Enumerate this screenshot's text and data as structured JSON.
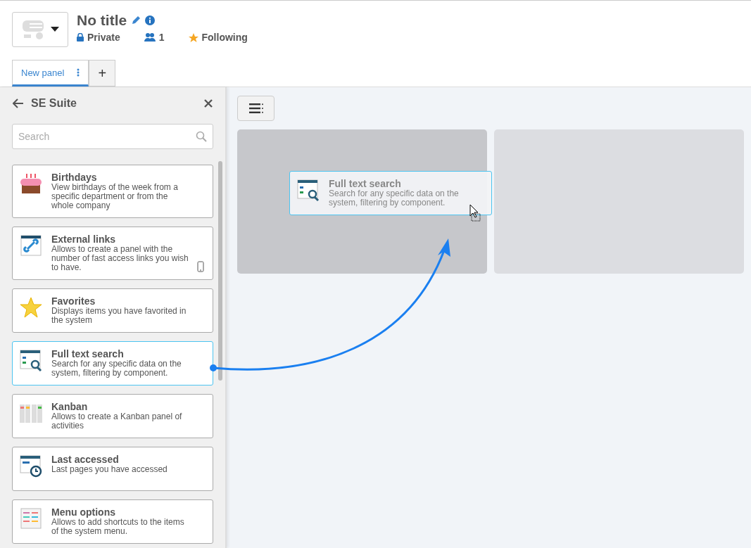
{
  "header": {
    "title": "No title",
    "privacy": "Private",
    "members": "1",
    "follow": "Following"
  },
  "tabs": [
    {
      "label": "New panel",
      "selected": true
    },
    {
      "label": "+",
      "selected": false
    }
  ],
  "sidebar": {
    "title": "SE Suite",
    "search": {
      "placeholder": "Search"
    },
    "widgets": [
      {
        "kind": "birthdays",
        "title": "Birthdays",
        "description": "View birthdays of the week from a specific department or from the whole company",
        "selected": false,
        "mobile": false
      },
      {
        "kind": "links",
        "title": "External links",
        "description": "Allows to create a panel with the number of fast access links you wish to have.",
        "selected": false,
        "mobile": true
      },
      {
        "kind": "favorites",
        "title": "Favorites",
        "description": "Displays items you have favorited in the system",
        "selected": false,
        "mobile": false
      },
      {
        "kind": "search",
        "title": "Full text search",
        "description": "Search for any specific data on the system, filtering by component.",
        "selected": true,
        "mobile": false
      },
      {
        "kind": "kanban",
        "title": "Kanban",
        "description": "Allows to create a Kanban panel of activities",
        "selected": false,
        "mobile": false
      },
      {
        "kind": "recent",
        "title": "Last accessed",
        "description": "Last pages you have accessed",
        "selected": false,
        "mobile": false
      },
      {
        "kind": "menu",
        "title": "Menu options",
        "description": "Allows to add shortcuts to the items of the system menu.",
        "selected": false,
        "mobile": false
      }
    ]
  },
  "drop_zones": [
    {
      "highlighted": true
    },
    {
      "highlighted": false
    }
  ],
  "drag_preview": {
    "kind": "search",
    "title": "Full text search",
    "description": "Search for any specific data on the system, filtering by component."
  }
}
